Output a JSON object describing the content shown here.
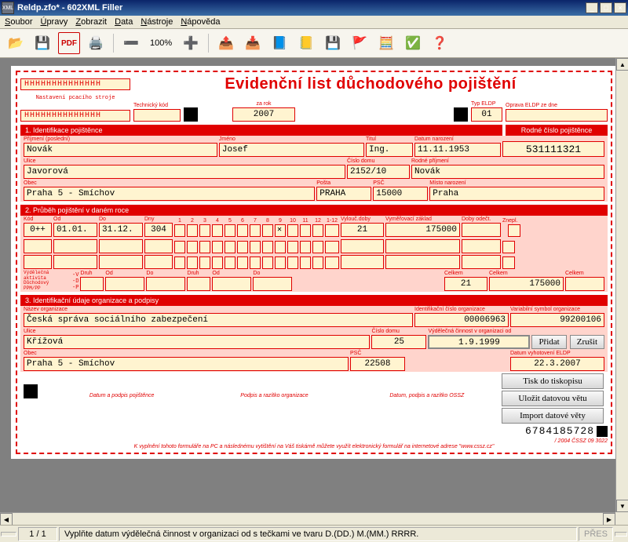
{
  "window": {
    "title": "Reldp.zfo* - 602XML Filler"
  },
  "menu": {
    "soubor": "Soubor",
    "upravy": "Úpravy",
    "zobrazit": "Zobrazit",
    "data": "Data",
    "nastroje": "Nástroje",
    "napoveda": "Nápověda"
  },
  "toolbar": {
    "zoom": "100%"
  },
  "form": {
    "hhh": "HHHHHHHHHHHHHH",
    "hdr_sub": "Nastavení pcacího stroje",
    "title": "Evidenční list důchodového pojištění",
    "tech_kod": "Technický kód",
    "za_rok_lbl": "za rok",
    "za_rok": "2007",
    "typ_eldp_lbl": "Typ ELDP",
    "typ_eldp": "01",
    "oprava_lbl": "Oprava ELDP ze dne",
    "sec1": "1. Identifikace pojištěnce",
    "rc_lbl": "Rodné číslo pojištěnce",
    "prijmeni_lbl": "Příjmení (poslední)",
    "prijmeni": "Novák",
    "jmeno_lbl": "Jméno",
    "jmeno": "Josef",
    "titul_lbl": "Titul",
    "titul": "Ing.",
    "datum_nar_lbl": "Datum narození",
    "datum_nar": "11.11.1953",
    "rc": "531111321",
    "ulice_lbl": "Ulice",
    "ulice": "Javorová",
    "cislo_domu_lbl": "Číslo domu",
    "cislo_domu": "2152/10",
    "rodne_prijmeni_lbl": "Rodné příjmení",
    "rodne_prijmeni": "Novák",
    "obec_lbl": "Obec",
    "obec": "Praha 5 - Smíchov",
    "posta_lbl": "Pošta",
    "posta": "PRAHA",
    "psc_lbl": "PSČ",
    "psc": "15000",
    "misto_nar_lbl": "Místo narození",
    "misto_nar": "Praha",
    "sec2": "2. Průběh pojištění v daném roce",
    "kod_lbl": "Kód",
    "od_lbl": "Od",
    "do_lbl": "Do",
    "dny_lbl": "Dny",
    "kod": "0++",
    "od": "01.01.",
    "do_": "31.12.",
    "dny": "304",
    "months": [
      "1",
      "2",
      "3",
      "4",
      "5",
      "6",
      "7",
      "8",
      "9",
      "10",
      "11",
      "12",
      "1-12"
    ],
    "vylouc_lbl": "Vylouč.doby",
    "vylouc": "21",
    "zaklad_lbl": "Vyměřovací základ",
    "zaklad": "175000",
    "odect_lbl": "Doby odečt.",
    "znepl_lbl": "Znepl.",
    "druh_lbl": "Druh",
    "celkem_lbl": "Celkem",
    "celkem1": "21",
    "celkem2": "175000",
    "vydelecna_note": "Výdělečná aktivita\nDůchodový\nPPM/PP",
    "vnote": "-V\n-D\n-P",
    "sec3": "3. Identifikační údaje organizace a podpisy",
    "nazev_org_lbl": "Název organizace",
    "nazev_org": "Česká správa sociálního zabezpečení",
    "ident_cislo_lbl": "Identifikační číslo organizace",
    "ident_cislo": "00006963",
    "var_symbol_lbl": "Variabilní symbol organizace",
    "var_symbol": "99200106",
    "ulice2_lbl": "Ulice",
    "ulice2": "Křížová",
    "cislo_domu2_lbl": "Číslo domu",
    "cislo_domu2": "25",
    "vydelecna_od_lbl": "Výdělečná činnost v organizaci od",
    "vydelecna_od": "1.9.1999",
    "obec2_lbl": "Obec",
    "obec2": "Praha 5 - Smíchov",
    "psc2_lbl": "PSČ",
    "psc2": "22508",
    "datum_vyhot_lbl": "Datum vyhotovení ELDP",
    "datum_vyhot": "22.3.2007",
    "pridat": "Přidat",
    "zrusit": "Zrušit",
    "btn_tisk": "Tisk do tiskopisu",
    "btn_ulozit": "Uložit datovou větu",
    "btn_import": "Import datové věty",
    "barcode": "6784185728",
    "sig1": "Datum a podpis pojištěnce",
    "sig2": "Podpis a razítko organizace",
    "sig3": "Datum, podpis a razítko OSSZ",
    "copyright": "/ 2004 ČSSZ 09 3022",
    "footnote": "K vyplnění tohoto formuláře na PC a následnému vytištění na Váš tiskárně můžete využít elektronický formulář na internetové adrese \"www.cssz.cz\""
  },
  "status": {
    "page": "1 / 1",
    "hint": "Vyplňte datum výdělečná činnost v organizaci od s tečkami ve tvaru D.(DD.) M.(MM.) RRRR.",
    "pres": "PŘES"
  }
}
